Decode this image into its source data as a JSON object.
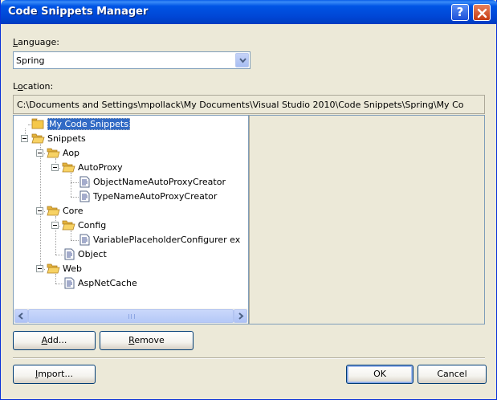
{
  "window": {
    "title": "Code Snippets Manager",
    "help_glyph": "?",
    "close_icon": "close-icon"
  },
  "language": {
    "label_accel": "L",
    "label_rest": "anguage:",
    "selected": "Spring"
  },
  "location": {
    "label_prefix": "L",
    "label_accel": "o",
    "label_rest": "cation:",
    "path": "C:\\Documents and Settings\\mpollack\\My Documents\\Visual Studio 2010\\Code Snippets\\Spring\\My Co"
  },
  "tree": {
    "nodes": [
      {
        "label": "My Code Snippets",
        "icon": "folder-icon",
        "depth": 0,
        "selected": true
      },
      {
        "label": "Snippets",
        "icon": "folder-open-icon",
        "depth": 0
      },
      {
        "label": "Aop",
        "icon": "folder-open-icon",
        "depth": 1
      },
      {
        "label": "AutoProxy",
        "icon": "folder-open-icon",
        "depth": 2
      },
      {
        "label": "ObjectNameAutoProxyCreator",
        "icon": "snippet-file-icon",
        "depth": 3
      },
      {
        "label": "TypeNameAutoProxyCreator",
        "icon": "snippet-file-icon",
        "depth": 3
      },
      {
        "label": "Core",
        "icon": "folder-open-icon",
        "depth": 1
      },
      {
        "label": "Config",
        "icon": "folder-open-icon",
        "depth": 2
      },
      {
        "label": "VariablePlaceholderConfigurer ex",
        "icon": "snippet-file-icon",
        "depth": 3
      },
      {
        "label": "Object",
        "icon": "snippet-file-icon",
        "depth": 2
      },
      {
        "label": "Web",
        "icon": "folder-open-icon",
        "depth": 1
      },
      {
        "label": "AspNetCache",
        "icon": "snippet-file-icon",
        "depth": 2
      }
    ]
  },
  "buttons": {
    "add_accel": "A",
    "add_rest": "dd...",
    "remove_accel": "R",
    "remove_rest": "emove",
    "import_accel": "I",
    "import_rest": "mport...",
    "ok": "OK",
    "cancel": "Cancel"
  },
  "colors": {
    "titlebar": "#0054e3",
    "dialog_bg": "#ece9d8",
    "selection": "#316ac5",
    "folder": "#f5c84a"
  }
}
